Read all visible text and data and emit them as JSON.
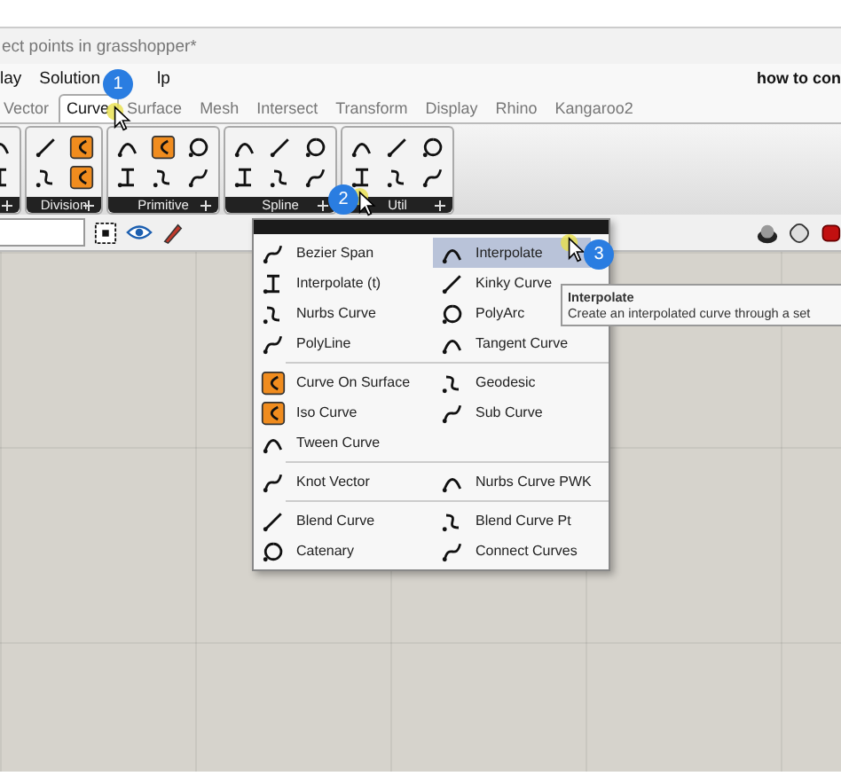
{
  "window": {
    "title": "ect points in grasshopper*"
  },
  "menu": {
    "items": [
      {
        "label": "lay"
      },
      {
        "label": "Solution"
      },
      {
        "label": "lp"
      }
    ],
    "right_text": "how to con"
  },
  "tabs": [
    {
      "label": "Vector",
      "selected": false
    },
    {
      "label": "Curve",
      "selected": true
    },
    {
      "label": "Surface",
      "selected": false
    },
    {
      "label": "Mesh",
      "selected": false
    },
    {
      "label": "Intersect",
      "selected": false
    },
    {
      "label": "Transform",
      "selected": false
    },
    {
      "label": "Display",
      "selected": false
    },
    {
      "label": "Rhino",
      "selected": false
    },
    {
      "label": "Kangaroo2",
      "selected": false
    }
  ],
  "ribbon": {
    "groups": [
      {
        "clipped": true
      },
      {
        "label": "Division"
      },
      {
        "label": "Primitive"
      },
      {
        "label": "Spline"
      },
      {
        "label": "Util"
      }
    ]
  },
  "dropdown": {
    "sections": [
      [
        {
          "label": "Bezier Span",
          "selected": false
        },
        {
          "label": "Interpolate",
          "selected": true
        },
        {
          "label": "Interpolate (t)",
          "selected": false
        },
        {
          "label": "Kinky Curve",
          "selected": false
        },
        {
          "label": "Nurbs Curve",
          "selected": false
        },
        {
          "label": "PolyArc",
          "selected": false
        },
        {
          "label": "PolyLine",
          "selected": false
        },
        {
          "label": "Tangent Curve",
          "selected": false
        }
      ],
      [
        {
          "label": "Curve On Surface",
          "selected": false
        },
        {
          "label": "Geodesic",
          "selected": false
        },
        {
          "label": "Iso Curve",
          "selected": false
        },
        {
          "label": "Sub Curve",
          "selected": false
        },
        {
          "label": "Tween Curve",
          "selected": false
        }
      ],
      [
        {
          "label": "Knot Vector",
          "selected": false
        },
        {
          "label": "Nurbs Curve PWK",
          "selected": false
        }
      ],
      [
        {
          "label": "Blend Curve",
          "selected": false
        },
        {
          "label": "Blend Curve Pt",
          "selected": false
        },
        {
          "label": "Catenary",
          "selected": false
        },
        {
          "label": "Connect Curves",
          "selected": false
        }
      ]
    ]
  },
  "tooltip": {
    "title": "Interpolate",
    "text": "Create an interpolated curve through a set"
  },
  "badges": [
    {
      "label": "1"
    },
    {
      "label": "2"
    },
    {
      "label": "3"
    }
  ]
}
